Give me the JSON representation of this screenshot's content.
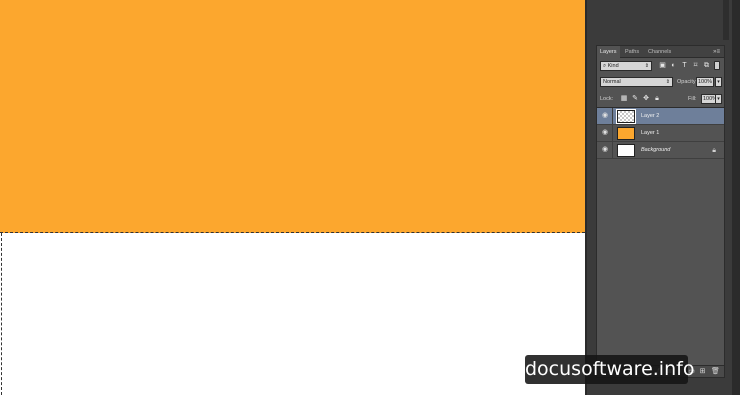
{
  "canvas": {
    "top_fill_color": "#fca72e",
    "bottom_fill_color": "#ffffff"
  },
  "layers_panel": {
    "tabs": [
      {
        "label": "Layers",
        "active": true
      },
      {
        "label": "Paths",
        "active": false
      },
      {
        "label": "Channels",
        "active": false
      }
    ],
    "menu_icon": "double-chevron-icon",
    "filter": {
      "kind_label": "Kind",
      "search_icon": "search-icon",
      "icons": [
        "image-icon",
        "adjustment-icon",
        "type-icon",
        "shape-icon",
        "smart-object-icon"
      ]
    },
    "blend_mode": "Normal",
    "opacity_label": "Opacity:",
    "opacity_value": "100%",
    "lock_label": "Lock:",
    "lock_icons": [
      "lock-transparent-icon",
      "lock-paint-icon",
      "lock-move-icon",
      "lock-all-icon"
    ],
    "fill_label": "Fill:",
    "fill_value": "100%",
    "layers": [
      {
        "name": "Layer 2",
        "selected": true,
        "thumb": "transparent",
        "locked": false
      },
      {
        "name": "Layer 1",
        "selected": false,
        "thumb": "orange",
        "locked": false
      },
      {
        "name": "Background",
        "selected": false,
        "thumb": "white",
        "locked": true
      }
    ],
    "footer_icons": [
      "link-icon",
      "fx-icon",
      "mask-icon",
      "adjustment-layer-icon",
      "group-folder-icon",
      "new-layer-icon",
      "trash-icon"
    ]
  },
  "watermark": {
    "text": "docusoftware.info"
  }
}
